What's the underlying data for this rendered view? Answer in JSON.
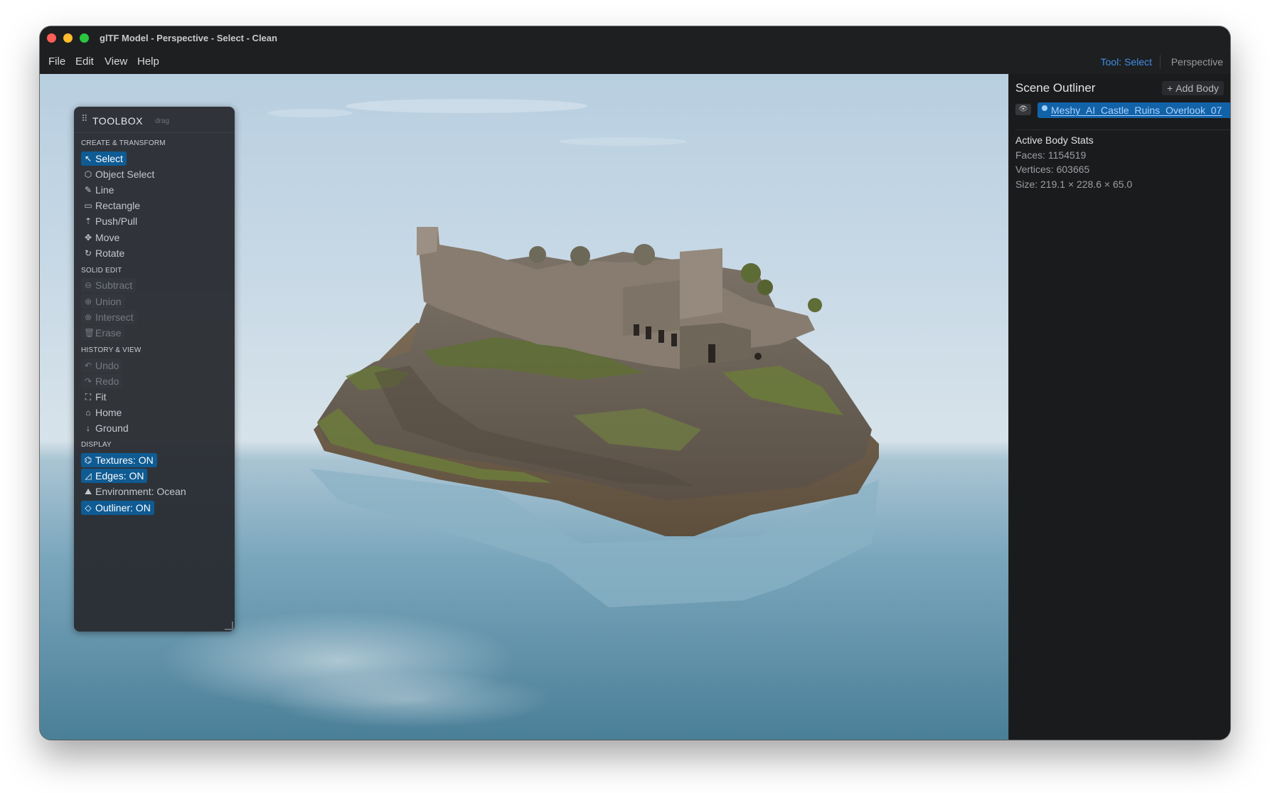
{
  "window": {
    "title": "glTF Model - Perspective - Select - Clean"
  },
  "menu": {
    "file": "File",
    "edit": "Edit",
    "view": "View",
    "help": "Help"
  },
  "status": {
    "tool": "Tool: Select",
    "view": "Perspective"
  },
  "toolbox": {
    "title": "TOOLBOX",
    "drag_hint": "drag",
    "sections": {
      "create": "CREATE & TRANSFORM",
      "solid": "SOLID EDIT",
      "history": "HISTORY & VIEW",
      "display": "DISPLAY"
    },
    "tools": {
      "select": "Select",
      "object_select": "Object Select",
      "line": "Line",
      "rectangle": "Rectangle",
      "push_pull": "Push/Pull",
      "move": "Move",
      "rotate": "Rotate",
      "subtract": "Subtract",
      "union": "Union",
      "intersect": "Intersect",
      "erase": "Erase",
      "undo": "Undo",
      "redo": "Redo",
      "fit": "Fit",
      "home": "Home",
      "ground": "Ground",
      "textures": "Textures: ON",
      "edges": "Edges: ON",
      "environment": "Environment: Ocean",
      "outliner": "Outliner: ON"
    }
  },
  "outliner": {
    "title": "Scene Outliner",
    "add_body": "Add Body",
    "body_name": "Meshy_AI_Castle_Ruins_Overlook_07",
    "stats_title": "Active Body Stats",
    "faces": "Faces: 1154519",
    "vertices": "Vertices: 603665",
    "size": "Size: 219.1 × 228.6 × 65.0"
  },
  "colors": {
    "accent": "#0f5b93",
    "link": "#3f8ee6"
  }
}
